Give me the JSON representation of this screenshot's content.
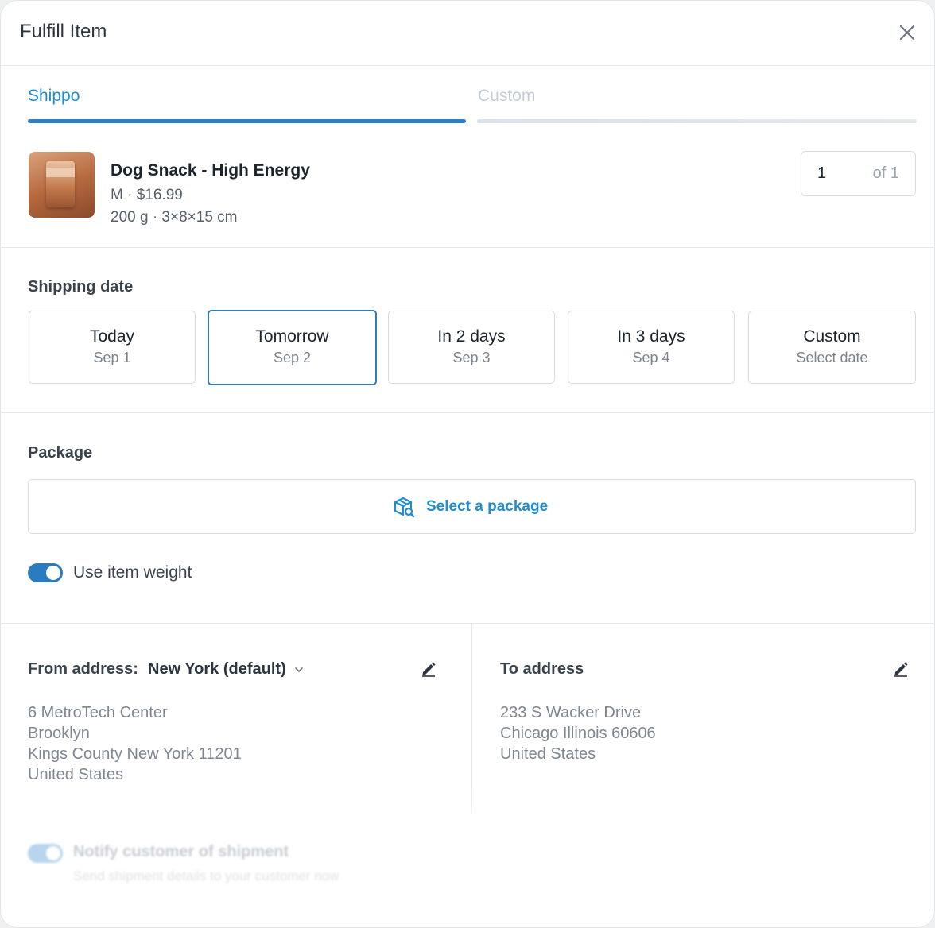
{
  "header": {
    "title": "Fulfill Item"
  },
  "tabs": [
    {
      "label": "Shippo",
      "active": true
    },
    {
      "label": "Custom",
      "active": false
    }
  ],
  "item": {
    "name": "Dog Snack - High Energy",
    "variant_price": "M · $16.99",
    "weight_dims": "200 g · 3×8×15 cm",
    "quantity": "1",
    "quantity_of": "of 1"
  },
  "shipping": {
    "label": "Shipping date",
    "options": [
      {
        "main": "Today",
        "sub": "Sep 1",
        "selected": false
      },
      {
        "main": "Tomorrow",
        "sub": "Sep 2",
        "selected": true
      },
      {
        "main": "In 2 days",
        "sub": "Sep 3",
        "selected": false
      },
      {
        "main": "In 3 days",
        "sub": "Sep 4",
        "selected": false
      },
      {
        "main": "Custom",
        "sub": "Select date",
        "selected": false
      }
    ]
  },
  "package": {
    "label": "Package",
    "select_label": "Select a package",
    "use_weight_label": "Use item weight",
    "use_weight_on": true
  },
  "from_address": {
    "title": "From address:",
    "selected": "New York (default)",
    "lines": [
      "6 MetroTech Center",
      "Brooklyn",
      "Kings County New York 11201",
      "United States"
    ]
  },
  "to_address": {
    "title": "To address",
    "lines": [
      "233 S Wacker Drive",
      "Chicago Illinois 60606",
      "United States"
    ]
  },
  "notify": {
    "label": "Notify customer of shipment",
    "sub": "Send shipment details to your customer now",
    "on": true
  },
  "colors": {
    "accent": "#1f8dd0",
    "selected_border": "#3479b8",
    "toggle": "#2a7cc1"
  }
}
